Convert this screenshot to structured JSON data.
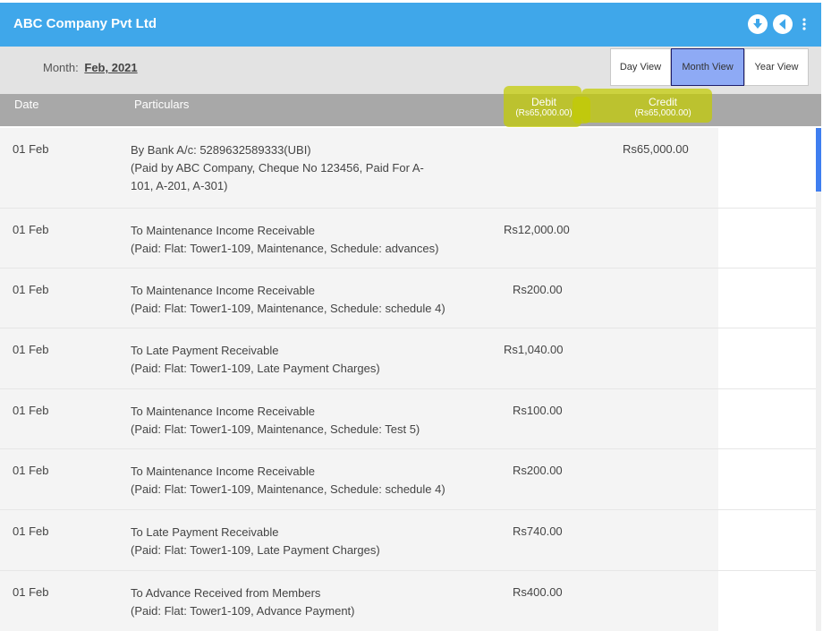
{
  "app": {
    "title": "ABC Company Pvt Ltd"
  },
  "header_icons": [
    "download-icon",
    "back-arrow-icon",
    "more-vertical-icon"
  ],
  "month": {
    "label": "Month:",
    "value": "Feb, 2021"
  },
  "views": {
    "day": "Day View",
    "month": "Month View",
    "year": "Year View",
    "selected": "Month View"
  },
  "columns": {
    "date": "Date",
    "particulars": "Particulars",
    "debit": "Debit",
    "debit_total": "(Rs65,000.00)",
    "credit": "Credit",
    "credit_total": "(Rs65,000.00)"
  },
  "rows": [
    {
      "date": "01 Feb",
      "line1": "By Bank A/c: 5289632589333(UBI)",
      "line2": "(Paid by ABC Company, Cheque No 123456, Paid For A-",
      "line3": "101, A-201, A-301)",
      "debit": "",
      "credit": "Rs65,000.00"
    },
    {
      "date": "01 Feb",
      "line1": "To Maintenance Income Receivable",
      "line2": "(Paid: Flat: Tower1-109, Maintenance, Schedule: advances)",
      "debit": "Rs12,000.00",
      "credit": ""
    },
    {
      "date": "01 Feb",
      "line1": "To Maintenance Income Receivable",
      "line2": "(Paid: Flat: Tower1-109, Maintenance, Schedule: schedule 4)",
      "debit": "Rs200.00",
      "credit": ""
    },
    {
      "date": "01 Feb",
      "line1": "To Late Payment Receivable",
      "line2": "(Paid: Flat: Tower1-109, Late Payment Charges)",
      "debit": "Rs1,040.00",
      "credit": ""
    },
    {
      "date": "01 Feb",
      "line1": "To Maintenance Income Receivable",
      "line2": "(Paid: Flat: Tower1-109, Maintenance, Schedule: Test 5)",
      "debit": "Rs100.00",
      "credit": ""
    },
    {
      "date": "01 Feb",
      "line1": "To Maintenance Income Receivable",
      "line2": "(Paid: Flat: Tower1-109, Maintenance, Schedule: schedule 4)",
      "debit": "Rs200.00",
      "credit": ""
    },
    {
      "date": "01 Feb",
      "line1": "To Late Payment Receivable",
      "line2": "(Paid: Flat: Tower1-109, Late Payment Charges)",
      "debit": "Rs740.00",
      "credit": ""
    },
    {
      "date": "01 Feb",
      "line1": "To Advance Received from Members",
      "line2": "(Paid: Flat: Tower1-109, Advance Payment)",
      "debit": "Rs400.00",
      "credit": ""
    }
  ],
  "colors": {
    "header": "#3fa7ea",
    "subbar": "#e3e3e3",
    "column_header": "#a8a8a8",
    "selected_tab": "#8eaaf5",
    "highlight": "#c4cc00",
    "scroll_thumb": "#3f7ef0"
  }
}
